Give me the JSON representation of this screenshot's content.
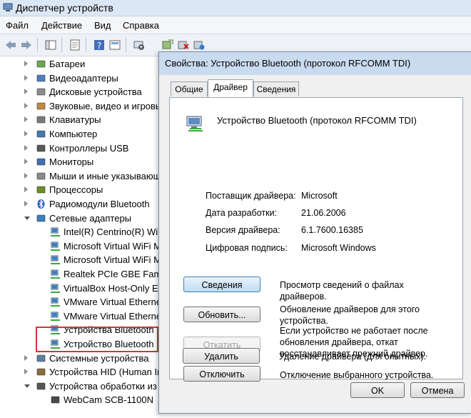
{
  "window": {
    "title": "Диспетчер устройств"
  },
  "menu": [
    "Файл",
    "Действие",
    "Вид",
    "Справка"
  ],
  "tree": {
    "items": [
      {
        "label": "Батареи",
        "icon": "battery-icon",
        "level": 1,
        "expander": "closed"
      },
      {
        "label": "Видеоадаптеры",
        "icon": "display-adapter-icon",
        "level": 1,
        "expander": "closed"
      },
      {
        "label": "Дисковые устройства",
        "icon": "disk-drive-icon",
        "level": 1,
        "expander": "closed"
      },
      {
        "label": "Звуковые, видео и игровые",
        "icon": "sound-icon",
        "level": 1,
        "expander": "closed"
      },
      {
        "label": "Клавиатуры",
        "icon": "keyboard-icon",
        "level": 1,
        "expander": "closed"
      },
      {
        "label": "Компьютер",
        "icon": "computer-icon",
        "level": 1,
        "expander": "closed"
      },
      {
        "label": "Контроллеры USB",
        "icon": "usb-icon",
        "level": 1,
        "expander": "closed"
      },
      {
        "label": "Мониторы",
        "icon": "monitor-icon",
        "level": 1,
        "expander": "closed"
      },
      {
        "label": "Мыши и иные указывающие",
        "icon": "mouse-icon",
        "level": 1,
        "expander": "closed"
      },
      {
        "label": "Процессоры",
        "icon": "cpu-icon",
        "level": 1,
        "expander": "closed"
      },
      {
        "label": "Радиомодули Bluetooth",
        "icon": "bluetooth-icon",
        "level": 1,
        "expander": "closed"
      },
      {
        "label": "Сетевые адаптеры",
        "icon": "network-adapter-icon",
        "level": 1,
        "expander": "open"
      },
      {
        "label": "Intel(R) Centrino(R) Wi",
        "icon": "network-card-icon",
        "level": 2,
        "expander": "none"
      },
      {
        "label": "Microsoft Virtual WiFi M",
        "icon": "network-card-icon",
        "level": 2,
        "expander": "none"
      },
      {
        "label": "Microsoft Virtual WiFi M",
        "icon": "network-card-icon",
        "level": 2,
        "expander": "none"
      },
      {
        "label": "Realtek PCIe GBE Famil",
        "icon": "network-card-icon",
        "level": 2,
        "expander": "none"
      },
      {
        "label": "VirtualBox Host-Only E",
        "icon": "network-card-icon",
        "level": 2,
        "expander": "none"
      },
      {
        "label": "VMware Virtual Etherne",
        "icon": "network-card-icon",
        "level": 2,
        "expander": "none"
      },
      {
        "label": "VMware Virtual Etherne",
        "icon": "network-card-icon",
        "level": 2,
        "expander": "none"
      },
      {
        "label": "Устройства Bluetooth",
        "icon": "network-card-icon",
        "level": 2,
        "expander": "none"
      },
      {
        "label": "Устройство Bluetooth",
        "icon": "network-card-icon",
        "level": 2,
        "expander": "none"
      },
      {
        "label": "Системные устройства",
        "icon": "system-device-icon",
        "level": 1,
        "expander": "closed"
      },
      {
        "label": "Устройства HID (Human In",
        "icon": "hid-icon",
        "level": 1,
        "expander": "closed"
      },
      {
        "label": "Устройства обработки из",
        "icon": "imaging-icon",
        "level": 1,
        "expander": "open"
      },
      {
        "label": "WebCam SCB-1100N",
        "icon": "webcam-icon",
        "level": 2,
        "expander": "none"
      }
    ]
  },
  "dialog": {
    "title": "Свойства: Устройство Bluetooth (протокол RFCOMM TDI)",
    "tabs": [
      "Общие",
      "Драйвер",
      "Сведения"
    ],
    "active_tab": "Драйвер",
    "device_name": "Устройство Bluetooth (протокол RFCOMM TDI)",
    "properties": [
      {
        "key": "Поставщик драйвера:",
        "value": "Microsoft"
      },
      {
        "key": "Дата разработки:",
        "value": "21.06.2006"
      },
      {
        "key": "Версия драйвера:",
        "value": "6.1.7600.16385"
      },
      {
        "key": "Цифровая подпись:",
        "value": "Microsoft Windows"
      }
    ],
    "actions": [
      {
        "label": "Сведения",
        "desc": "Просмотр сведений о файлах драйверов.",
        "state": "default"
      },
      {
        "label": "Обновить...",
        "desc": "Обновление драйверов для этого устройства.",
        "state": "normal"
      },
      {
        "label": "Откатить",
        "desc": "Если устройство не работает после обновления драйвера, откат восстанавливает прежний драйвер.",
        "state": "disabled"
      },
      {
        "label": "Отключить",
        "desc": "Отключение выбранного устройства.",
        "state": "normal"
      },
      {
        "label": "Удалить",
        "desc": "Удаление драйвера (для опытных).",
        "state": "normal"
      }
    ],
    "ok_label": "OK",
    "cancel_label": "Отмена"
  },
  "colors": {
    "highlight_box": "#d4343a",
    "title_bg": "#c9dbef"
  }
}
